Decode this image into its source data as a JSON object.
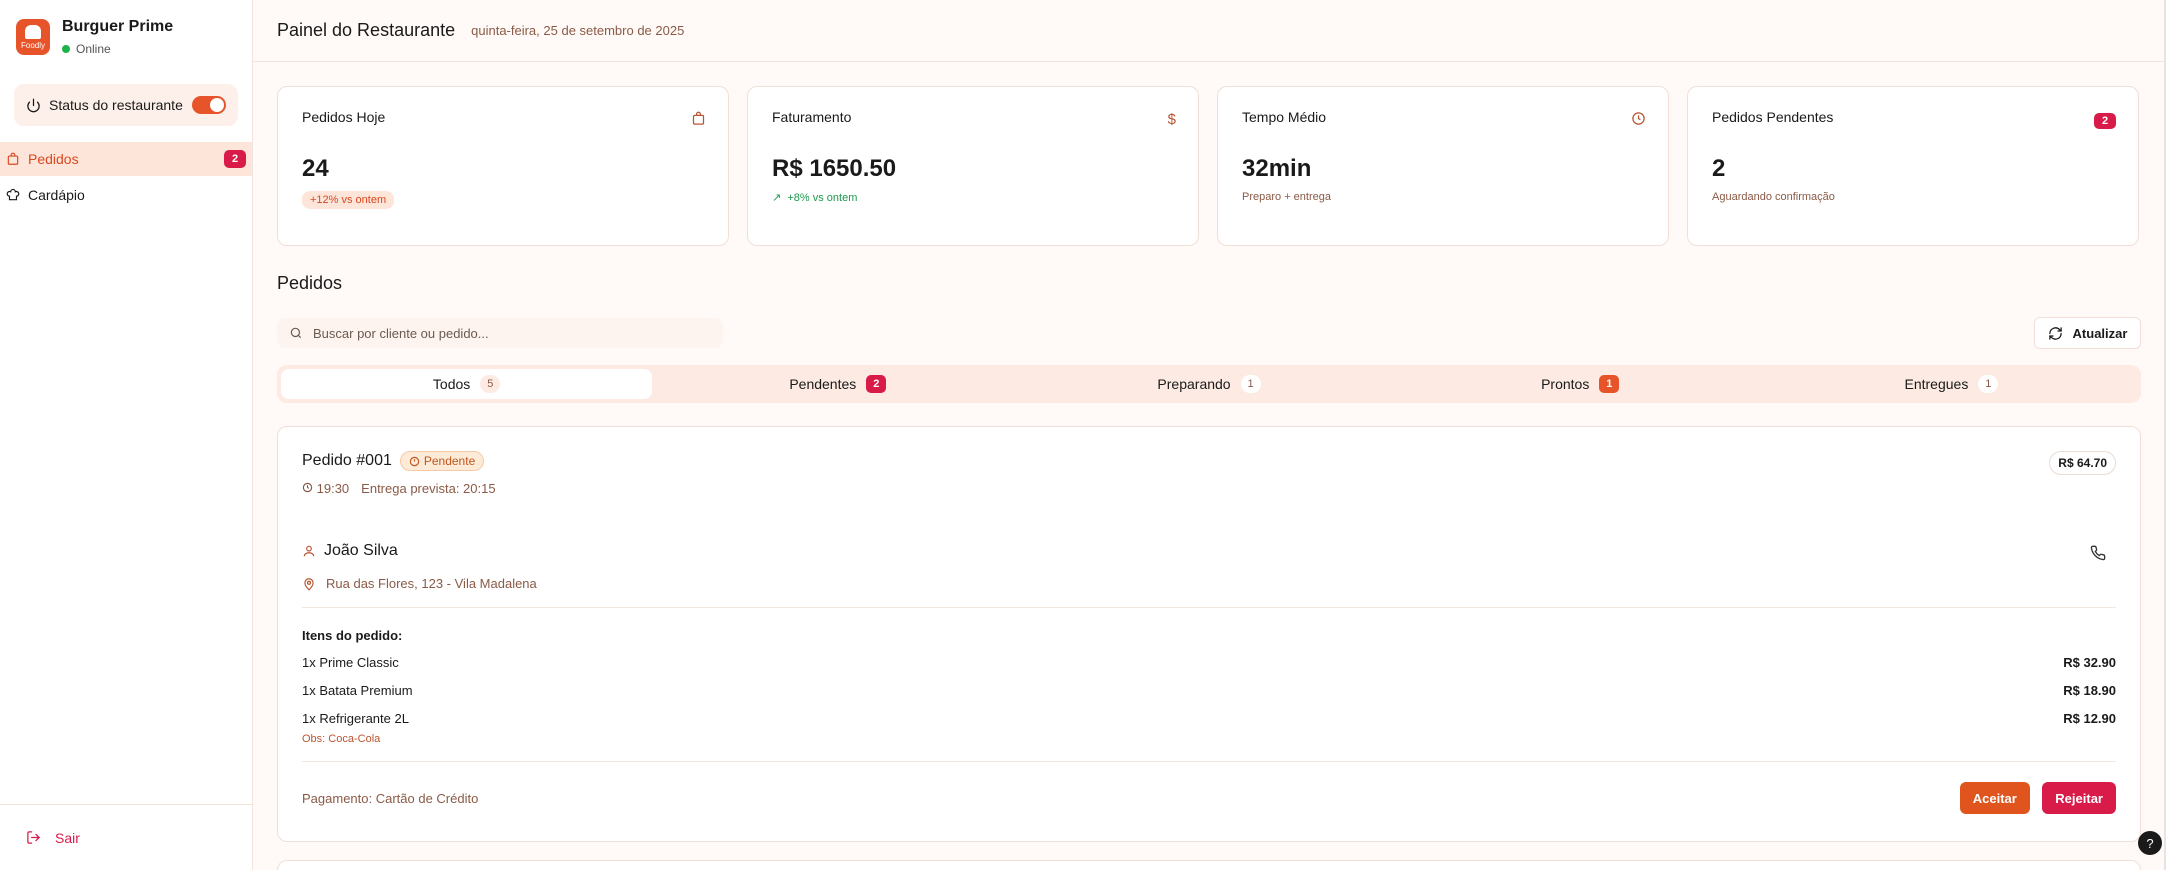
{
  "brand": {
    "name": "Burguer Prime",
    "status": "Online",
    "logo_text": "Foodly"
  },
  "sidebar": {
    "status_label": "Status do restaurante",
    "items": [
      {
        "label": "Pedidos",
        "badge": "2",
        "icon": "bag-icon"
      },
      {
        "label": "Cardápio",
        "icon": "chef-hat-icon"
      }
    ],
    "logout_label": "Sair"
  },
  "header": {
    "title": "Painel do Restaurante",
    "date": "quinta-feira, 25 de setembro de 2025"
  },
  "stats": [
    {
      "title": "Pedidos Hoje",
      "value": "24",
      "sub": "+12% vs ontem",
      "icon": "bag-icon"
    },
    {
      "title": "Faturamento",
      "value": "R$ 1650.50",
      "sub": "+8% vs ontem",
      "icon": "dollar-icon"
    },
    {
      "title": "Tempo Médio",
      "value": "32min",
      "sub": "Preparo + entrega",
      "icon": "clock-icon"
    },
    {
      "title": "Pedidos Pendentes",
      "value": "2",
      "sub": "Aguardando confirmação",
      "badge": "2"
    }
  ],
  "orders": {
    "title": "Pedidos",
    "search_placeholder": "Buscar por cliente ou pedido...",
    "refresh_label": "Atualizar",
    "tabs": [
      {
        "label": "Todos",
        "count": "5"
      },
      {
        "label": "Pendentes",
        "count": "2"
      },
      {
        "label": "Preparando",
        "count": "1"
      },
      {
        "label": "Prontos",
        "count": "1"
      },
      {
        "label": "Entregues",
        "count": "1"
      }
    ],
    "order": {
      "id": "Pedido #001",
      "status": "Pendente",
      "total": "R$ 64.70",
      "time": "19:30",
      "eta": "Entrega prevista: 20:15",
      "customer": "João Silva",
      "address": "Rua das Flores, 123 - Vila Madalena",
      "items_title": "Itens do pedido:",
      "items": [
        {
          "name": "1x Prime Classic",
          "price": "R$ 32.90"
        },
        {
          "name": "1x Batata Premium",
          "price": "R$ 18.90"
        },
        {
          "name": "1x Refrigerante 2L",
          "price": "R$ 12.90"
        }
      ],
      "obs": "Obs: Coca-Cola",
      "payment": "Pagamento: Cartão de Crédito",
      "accept_label": "Aceitar",
      "reject_label": "Rejeitar"
    }
  },
  "help_label": "?",
  "colors": {
    "accent": "#e8542a",
    "danger": "#d81b48",
    "success": "#1db34b"
  }
}
